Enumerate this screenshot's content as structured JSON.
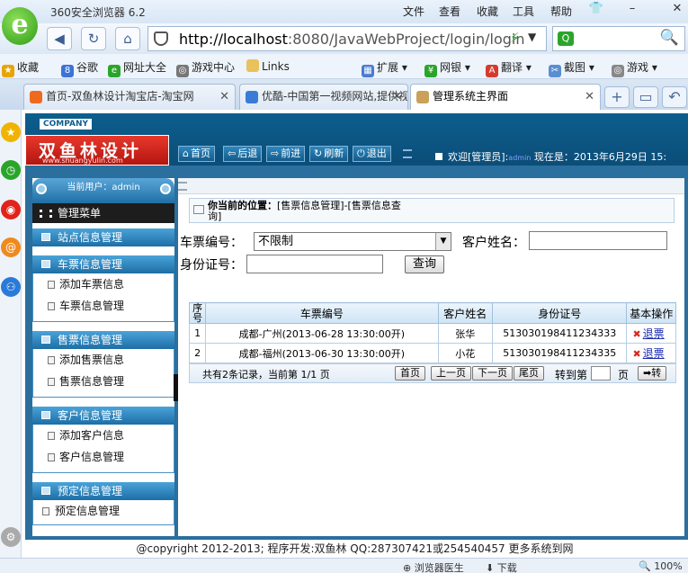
{
  "browser": {
    "app_title": "360安全浏览器 6.2",
    "menu": [
      "文件",
      "查看",
      "收藏",
      "工具",
      "帮助"
    ],
    "address": {
      "host": "http://localhost",
      "rest": ":8080/JavaWebProject/login/login"
    },
    "favorites": [
      "收藏",
      "谷歌",
      "网址大全",
      "游戏中心",
      "Links",
      "扩展",
      "网银",
      "翻译",
      "截图",
      "游戏"
    ],
    "tabs": [
      {
        "label": "首页-双鱼林设计淘宝店-淘宝网",
        "active": false
      },
      {
        "label": "优酷-中国第一视频网站,提供视",
        "active": false
      },
      {
        "label": "管理系统主界面",
        "active": true
      }
    ],
    "status": {
      "left": "浏览器医生",
      "download": "下载",
      "zoom": "100%"
    }
  },
  "header": {
    "company": "COMPANY",
    "brand_name": "双鱼林设计",
    "brand_site": "www.shuangyulin.com",
    "buttons": [
      {
        "icon": "home-icon",
        "glyph": "⌂",
        "label": "首页"
      },
      {
        "icon": "back-icon",
        "glyph": "⇦",
        "label": "后退"
      },
      {
        "icon": "forward-icon",
        "glyph": "⇨",
        "label": "前进"
      },
      {
        "icon": "refresh-icon",
        "glyph": "↻",
        "label": "刷新"
      },
      {
        "icon": "power-icon",
        "glyph": "⏻",
        "label": "退出"
      }
    ],
    "welcome_prefix": "欢迎[管理员]:",
    "welcome_user": "admin",
    "welcome_now": "现在是：2013年6月29日 15:"
  },
  "left": {
    "current_user": "当前用户：admin",
    "menu_title": "管理菜单",
    "sections": [
      {
        "title": "站点信息管理",
        "items": []
      },
      {
        "title": "车票信息管理",
        "items": [
          "添加车票信息",
          "车票信息管理"
        ]
      },
      {
        "title": "售票信息管理",
        "items": [
          "添加售票信息",
          "售票信息管理"
        ]
      },
      {
        "title": "客户信息管理",
        "items": [
          "添加客户信息",
          "客户信息管理"
        ]
      },
      {
        "title": "预定信息管理",
        "items": [
          "预定信息管理"
        ]
      }
    ]
  },
  "main": {
    "breadcrumb_label": "你当前的位置：",
    "breadcrumb_path": "[售票信息管理]-[售票信息查询]",
    "form": {
      "ticket_label": "车票编号：",
      "ticket_value": "不限制",
      "customer_label": "客户姓名：",
      "customer_value": "",
      "idcard_label": "身份证号：",
      "idcard_value": "",
      "query_button": "查询"
    },
    "table": {
      "headers": [
        "序号",
        "车票编号",
        "客户姓名",
        "身份证号",
        "基本操作"
      ],
      "rows": [
        {
          "no": "1",
          "ticket": "成都-广州(2013-06-28 13:30:00开)",
          "customer": "张华",
          "idcard": "513030198411234333",
          "action": "退票"
        },
        {
          "no": "2",
          "ticket": "成都-福州(2013-06-30 13:30:00开)",
          "customer": "小花",
          "idcard": "513030198411234335",
          "action": "退票"
        }
      ]
    },
    "pager": {
      "info": "共有2条记录，当前第 1/1 页",
      "first": "首页",
      "prev": "上一页",
      "next": "下一页",
      "last": "尾页",
      "goto_label": "转到第",
      "page_unit": "页",
      "goto_button": "➡转"
    }
  },
  "footer": {
    "text": "@copyright 2012-2013; 程序开发:双鱼林  QQ:287307421或254540457  更多系统到网"
  }
}
